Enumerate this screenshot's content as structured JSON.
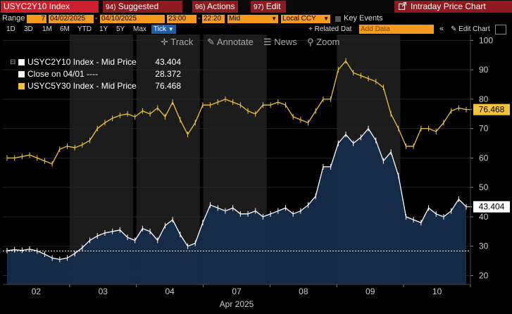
{
  "toolbar": {
    "ticker": "USYC2Y10 Index",
    "suggested": {
      "num": "94)",
      "label": "Suggested Charts"
    },
    "actions": {
      "num": "96)",
      "label": "Actions"
    },
    "edit": {
      "num": "97)",
      "label": "Edit"
    },
    "title": "Intraday Price Chart"
  },
  "range_bar": {
    "range_label": "Range",
    "range_count": "7",
    "start_date": "04/02/2025",
    "end_date": "04/10/2025",
    "start_time": "23:00",
    "end_time": "22:20",
    "price_type": "Mid",
    "currency": "Local CCY",
    "key_events_label": "Key Events"
  },
  "period_bar": {
    "periods": [
      "1D",
      "3D",
      "1M",
      "6M",
      "YTD",
      "1Y",
      "5Y",
      "Max"
    ],
    "selected": "Tick",
    "related_label": "+ Related Dat",
    "add_data_placeholder": "Add Data",
    "edit_chart_label": "Edit Chart"
  },
  "chart_tools": {
    "track": "Track",
    "annotate": "Annotate",
    "news": "News",
    "zoom": "Zoom"
  },
  "legend": [
    {
      "name": "USYC2Y10 Index - Mid Price",
      "value": "43.404",
      "color": "#ffffff"
    },
    {
      "name": "Close on 04/01 ----",
      "value": "28.372",
      "color": "#ffffff"
    },
    {
      "name": "USYC5Y30 Index - Mid Price",
      "value": "76.468",
      "color": "#f0c43a"
    }
  ],
  "chart_data": {
    "type": "area",
    "x_ticks": [
      "02",
      "03",
      "04",
      "07",
      "08",
      "09",
      "10"
    ],
    "x_sublabel": "Apr 2025",
    "y_ticks": [
      20,
      30,
      40,
      50,
      60,
      70,
      80,
      90,
      100
    ],
    "ylim": [
      17,
      102
    ],
    "reference_line": 28.372,
    "series": [
      {
        "name": "USYC2Y10 Index - Mid Price",
        "color": "#ffffff",
        "fill": "#152c4a",
        "last_value": "43.404",
        "values": [
          28.5,
          28.8,
          28.6,
          29,
          28.4,
          27.3,
          26,
          25.5,
          26,
          27.5,
          29.5,
          32,
          33.5,
          34.5,
          35,
          35.5,
          33,
          32,
          36,
          35,
          32,
          37,
          39,
          34,
          30,
          31,
          38,
          44,
          43,
          42,
          43,
          41,
          41,
          42,
          40,
          41,
          42,
          43,
          41,
          42,
          44,
          47,
          57,
          57,
          65,
          68,
          65,
          67,
          70,
          66,
          59,
          62,
          54,
          40,
          39,
          38,
          43,
          41,
          40,
          42,
          46,
          43.404
        ]
      },
      {
        "name": "USYC5Y30 Index - Mid Price",
        "color": "#f0c43a",
        "last_value": "76.468",
        "values": [
          60,
          60,
          60.5,
          61,
          60,
          59,
          58,
          63,
          64,
          63.5,
          64.5,
          66,
          70,
          72,
          73.5,
          74.5,
          75,
          74,
          76,
          75,
          77,
          74,
          79,
          73,
          68,
          72,
          78,
          78,
          79,
          80,
          79,
          78,
          76,
          75,
          78,
          78,
          79,
          78,
          74,
          73,
          72,
          76,
          80,
          80,
          90,
          93,
          89,
          88,
          87,
          86,
          84,
          75,
          70,
          64,
          64,
          70,
          70,
          69,
          72,
          76,
          77,
          76.468
        ]
      }
    ]
  }
}
